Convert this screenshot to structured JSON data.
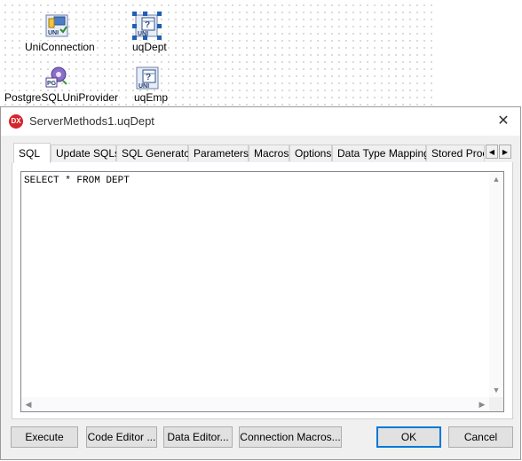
{
  "designer": {
    "components": [
      {
        "id": "uniconnection",
        "label": "UniConnection",
        "icon": "uni-connection-icon"
      },
      {
        "id": "uqdept",
        "label": "uqDept",
        "icon": "uni-query-icon",
        "selected": true
      },
      {
        "id": "postgresqluniprovider",
        "label": "PostgreSQLUniProvider",
        "icon": "pg-provider-icon"
      },
      {
        "id": "uqemp",
        "label": "uqEmp",
        "icon": "uni-query-icon"
      }
    ]
  },
  "dialog": {
    "logo_text": "DX",
    "title": "ServerMethods1.uqDept",
    "close_glyph": "✕",
    "tabs": [
      "SQL",
      "Update SQLs",
      "SQL Generator",
      "Parameters",
      "Macros",
      "Options",
      "Data Type Mapping",
      "Stored Proc"
    ],
    "active_tab": "SQL",
    "sql_text": "SELECT * FROM DEPT",
    "buttons": {
      "execute": "Execute",
      "code_editor": "Code Editor ...",
      "data_editor": "Data Editor...",
      "connection_macros": "Connection Macros...",
      "ok": "OK",
      "cancel": "Cancel"
    }
  },
  "colors": {
    "accent": "#0078d7",
    "logo_red": "#d6262b",
    "selection_handle": "#1f5fb4"
  }
}
